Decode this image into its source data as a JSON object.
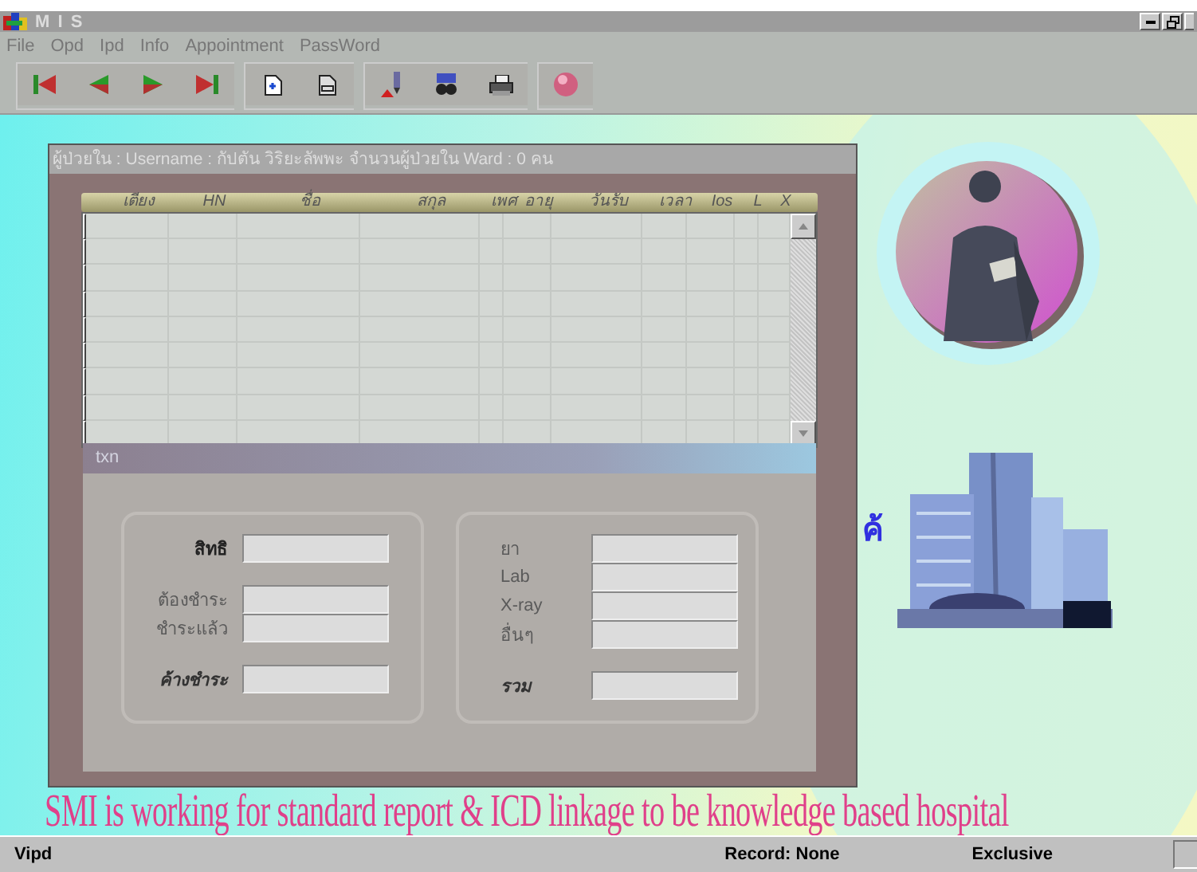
{
  "window": {
    "title": "M I S"
  },
  "menu": [
    {
      "label": "File"
    },
    {
      "label": "Opd"
    },
    {
      "label": "Ipd"
    },
    {
      "label": "Info"
    },
    {
      "label": "Appointment"
    },
    {
      "label": "PassWord"
    }
  ],
  "toolbar": [
    {
      "kind": "first"
    },
    {
      "kind": "prev"
    },
    {
      "kind": "next"
    },
    {
      "kind": "last"
    },
    {
      "kind": "sep"
    },
    {
      "kind": "new"
    },
    {
      "kind": "doc"
    },
    {
      "kind": "sep"
    },
    {
      "kind": "edit"
    },
    {
      "kind": "find"
    },
    {
      "kind": "print"
    },
    {
      "kind": "sep"
    },
    {
      "kind": "exit"
    }
  ],
  "child_window": {
    "title": "ผู้ป่วยใน  :  Username : กัปตัน  วิริยะลัพพะ  จำนวนผู้ป่วยใน Ward : 0 คน",
    "table": {
      "columns": [
        "เตียง",
        "HN",
        "ชื่อ",
        "สกุล",
        "เพศ",
        "อายุ",
        "วันรับ",
        "เวลา",
        "Ios",
        "L",
        "X"
      ]
    },
    "txn": {
      "title": "txn",
      "left_group": [
        {
          "label": "สิทธิ"
        },
        {
          "label": "ต้องชำระ"
        },
        {
          "label": "ชำระแล้ว"
        },
        {
          "label": "ค้างชำระ"
        }
      ],
      "right_group": [
        {
          "label": "ยา"
        },
        {
          "label": "Lab"
        },
        {
          "label": "X-ray"
        },
        {
          "label": "อื่นๆ"
        },
        {
          "label": "รวม"
        }
      ]
    }
  },
  "desktop": {
    "partial_text": "ค้",
    "banner": "SMI is working for standard report & ICD linkage to be knowledge based hospital"
  },
  "status_bar": {
    "panels": [
      "Vipd",
      "Record: None",
      "Exclusive"
    ]
  }
}
